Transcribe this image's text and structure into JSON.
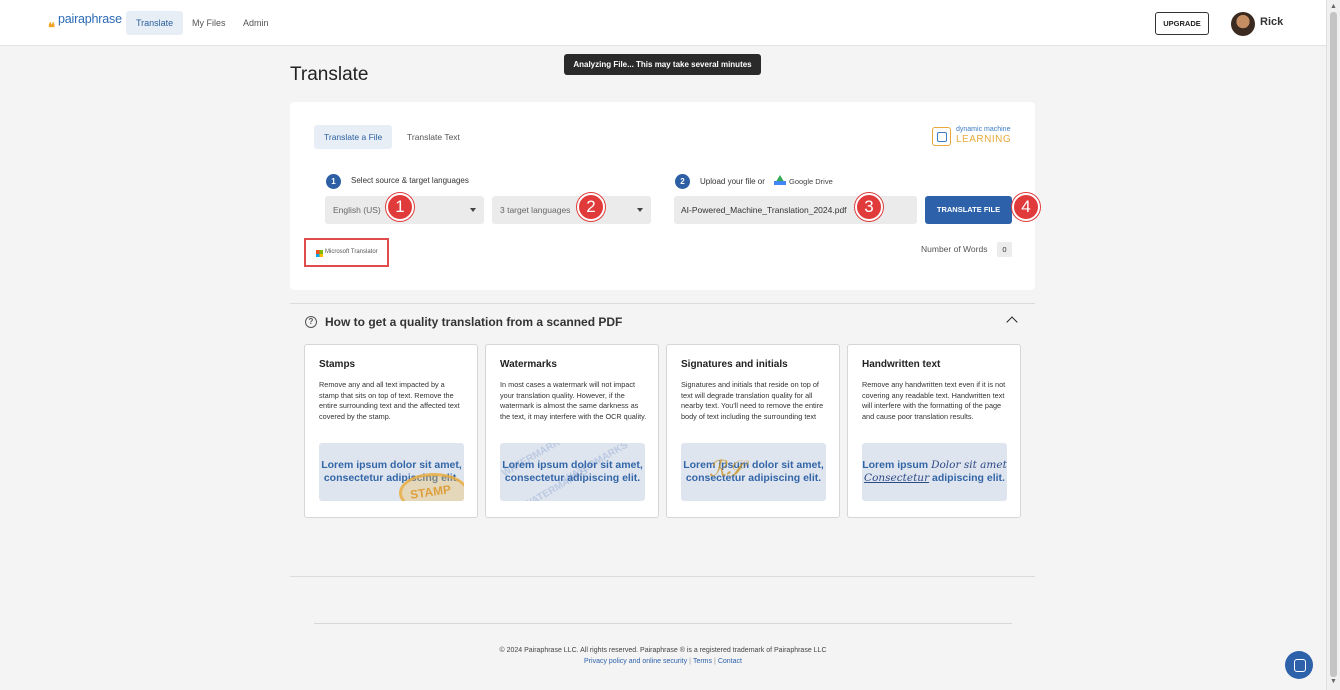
{
  "header": {
    "logo_text": "pairaphrase",
    "nav": [
      "Translate",
      "My Files",
      "Admin"
    ],
    "upgrade_label": "UPGRADE",
    "user_name": "Rick"
  },
  "toast": "Analyzing File... This may take several minutes",
  "page_title": "Translate",
  "tabs": [
    "Translate a File",
    "Translate Text"
  ],
  "dml_logo": {
    "small": "dynamic machine",
    "big": "LEARNING"
  },
  "step1": {
    "number": "1",
    "label": "Select source & target languages"
  },
  "step2": {
    "number": "2",
    "label": "Upload your file or",
    "drive_label": "Google Drive"
  },
  "source_language": "English (US)",
  "target_languages": "3 target languages",
  "file_name": "AI-Powered_Machine_Translation_2024.pdf",
  "translate_button": "TRANSLATE FILE",
  "callouts": [
    "1",
    "2",
    "3",
    "4"
  ],
  "ms_translator": "Microsoft Translator",
  "words": {
    "label": "Number of Words",
    "count": "0"
  },
  "howto": {
    "title": "How to get a quality translation from a scanned PDF",
    "cards": [
      {
        "title": "Stamps",
        "desc": "Remove any and all text impacted by a stamp that sits on top of text. Remove the entire surrounding text and the affected text covered by the stamp.",
        "sample": "Lorem ipsum dolor sit amet, consectetur adipiscing elit.",
        "overlay": "STAMP"
      },
      {
        "title": "Watermarks",
        "desc": "In most cases a watermark will not impact your translation quality. However, if the watermark is almost the same darkness as the text, it may interfere with the OCR quality.",
        "sample": "Lorem ipsum dolor sit amet, consectetur adipiscing elit.",
        "overlay": "WATERMARKS"
      },
      {
        "title": "Signatures and initials",
        "desc": "Signatures and initials that reside on top of text will degrade translation quality for all nearby text. You'll need to remove the entire body of text including the surrounding text",
        "sample": "Lorem ipsum dolor sit amet, consectetur adipiscing elit.",
        "overlay": ""
      },
      {
        "title": "Handwritten text",
        "desc": "Remove any handwritten text even if it is not covering any readable text. Handwritten text will interfere with the formatting of the page and cause poor translation results.",
        "sample_a": "Lorem ipsum",
        "sample_hw1": "Dolor sit amet",
        "sample_hw2": "Consectetur",
        "sample_b": "adipiscing elit."
      }
    ]
  },
  "footer": {
    "copyright": "© 2024 Pairaphrase LLC. All rights reserved. Pairaphrase ® is a registered trademark of Pairaphrase LLC",
    "links": [
      "Privacy policy and online security",
      "Terms",
      "Contact"
    ]
  },
  "colors": {
    "brand_blue": "#2d62ab",
    "accent_orange": "#f0a223",
    "callout_red": "#e03a3a"
  }
}
